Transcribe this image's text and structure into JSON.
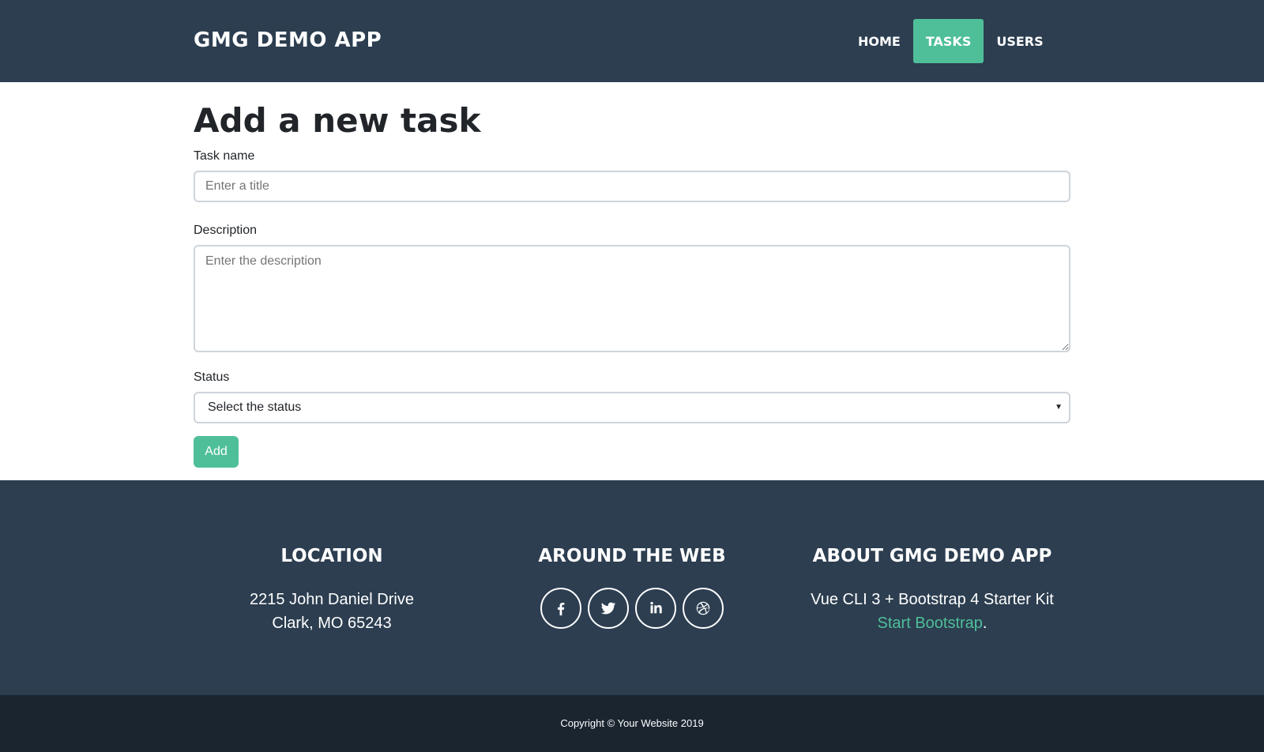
{
  "navbar": {
    "brand": "GMG DEMO APP",
    "items": [
      {
        "label": "HOME"
      },
      {
        "label": "TASKS",
        "active": true
      },
      {
        "label": "USERS"
      }
    ]
  },
  "form": {
    "title": "Add a new task",
    "task_name": {
      "label": "Task name",
      "placeholder": "Enter a title",
      "value": ""
    },
    "description": {
      "label": "Description",
      "placeholder": "Enter the description",
      "value": ""
    },
    "status": {
      "label": "Status",
      "selected": "Select the status"
    },
    "submit_label": "Add"
  },
  "footer": {
    "location": {
      "heading": "LOCATION",
      "line1": "2215 John Daniel Drive",
      "line2": "Clark, MO 65243"
    },
    "web": {
      "heading": "AROUND THE WEB",
      "icons": [
        "facebook-icon",
        "twitter-icon",
        "linkedin-icon",
        "dribbble-icon"
      ]
    },
    "about": {
      "heading": "ABOUT GMG DEMO APP",
      "text": "Vue CLI 3 + Bootstrap 4 Starter Kit",
      "link": "Start Bootstrap",
      "suffix": "."
    }
  },
  "copyright": "Copyright © Your Website 2019",
  "colors": {
    "navbar": "#2c3e50",
    "accent": "#4fbf99",
    "copyright_bg": "#1a2530"
  }
}
